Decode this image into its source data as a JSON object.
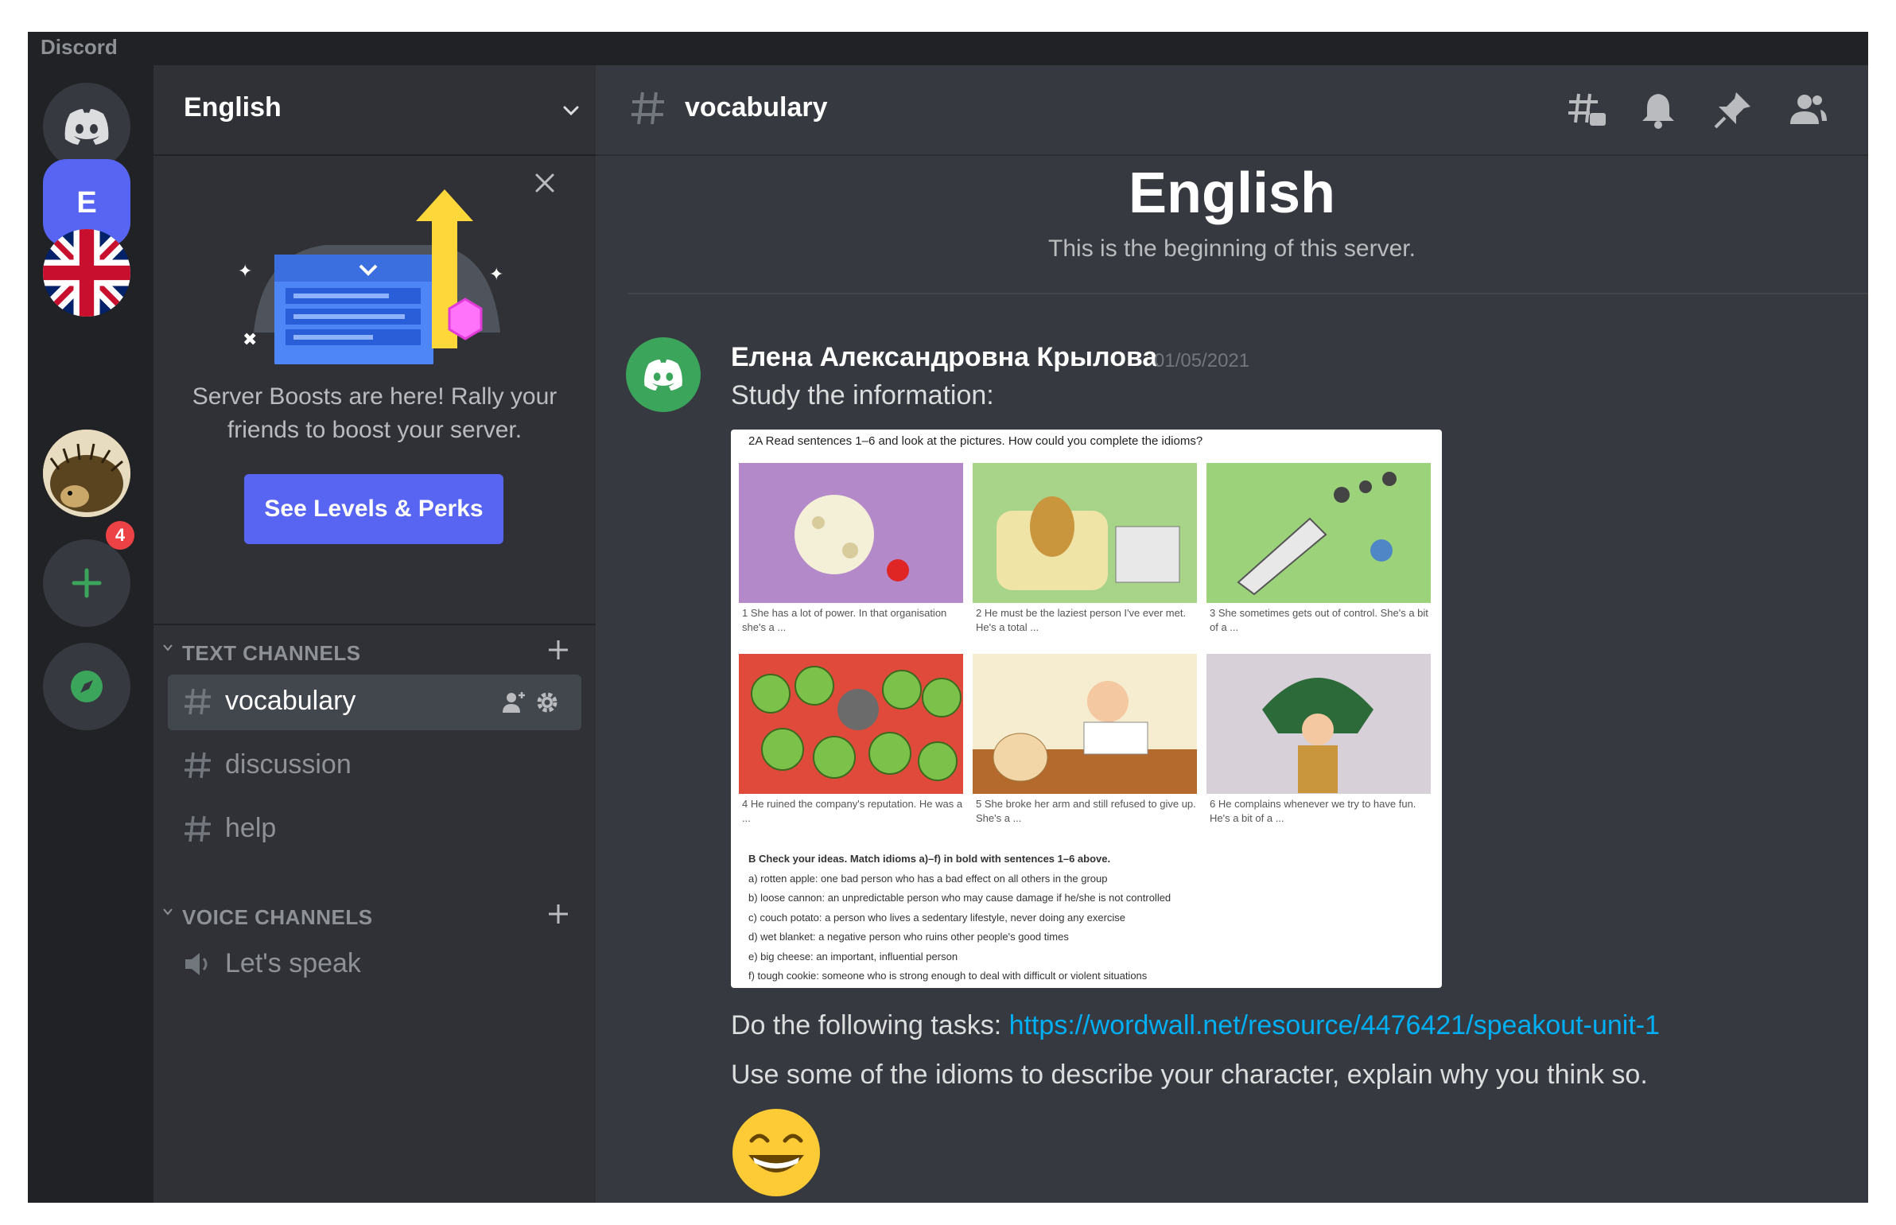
{
  "window": {
    "title": "Discord"
  },
  "servers": [
    {
      "name": "Discord home",
      "icon": "discord-logo-icon"
    },
    {
      "name": "E",
      "initial": "E",
      "selected": true
    },
    {
      "name": "UK flag server",
      "icon": "uk-flag-icon"
    },
    {
      "name": "Hedgehog server",
      "icon": "hedgehog-icon",
      "mentions": "4"
    },
    {
      "name": "Add a Server",
      "icon": "plus-icon"
    },
    {
      "name": "Explore Public Servers",
      "icon": "compass-icon"
    }
  ],
  "sidebar": {
    "server_name": "English",
    "boost": {
      "text": "Server Boosts are here! Rally your friends to boost your server.",
      "button": "See Levels & Perks"
    },
    "text_category": "TEXT CHANNELS",
    "text_channels": [
      "vocabulary",
      "discussion",
      "help"
    ],
    "voice_category": "VOICE CHANNELS",
    "voice_channels": [
      "Let's speak"
    ]
  },
  "main": {
    "channel": "vocabulary",
    "welcome_title": "English",
    "welcome_subtitle": "This is the beginning of this server.",
    "message": {
      "author": "Елена Александровна Крылова",
      "timestamp": "01/05/2021",
      "line1": "Study the information:",
      "line2_prefix": "Do the following tasks: ",
      "link": "https://wordwall.net/resource/4476421/speakout-unit-1",
      "line3": "Use some of the idioms to describe your character, explain why you think so."
    },
    "attachment": {
      "header": "2A  Read sentences 1–6 and look at the pictures. How could you complete the idioms?",
      "captions": [
        "1  She has a lot of power. In that organisation she's a ...",
        "2  He must be the laziest person I've ever met. He's a total ...",
        "3  She sometimes gets out of control. She's a bit of a ...",
        "4  He ruined the company's reputation. He was a ...",
        "5  She broke her arm and still refused to give up. She's a ...",
        "6  He complains whenever we try to have fun. He's a bit of a ..."
      ],
      "part_b_title": "B  Check your ideas. Match idioms a)–f) in bold with sentences 1–6 above.",
      "idioms": [
        "a)  rotten apple: one bad person who has a bad effect on all others in the group",
        "b)  loose cannon: an unpredictable person who may cause damage if he/she is not controlled",
        "c)  couch potato: a person who lives a sedentary lifestyle, never doing any exercise",
        "d)  wet blanket: a negative person who ruins other people's good times",
        "e)  big cheese: an important, influential person",
        "f)  tough cookie: someone who is strong enough to deal with difficult or violent situations"
      ]
    }
  },
  "colors": {
    "blurple": "#5865f2",
    "green": "#3ba55c",
    "link": "#00aff4",
    "red": "#ed4245"
  }
}
